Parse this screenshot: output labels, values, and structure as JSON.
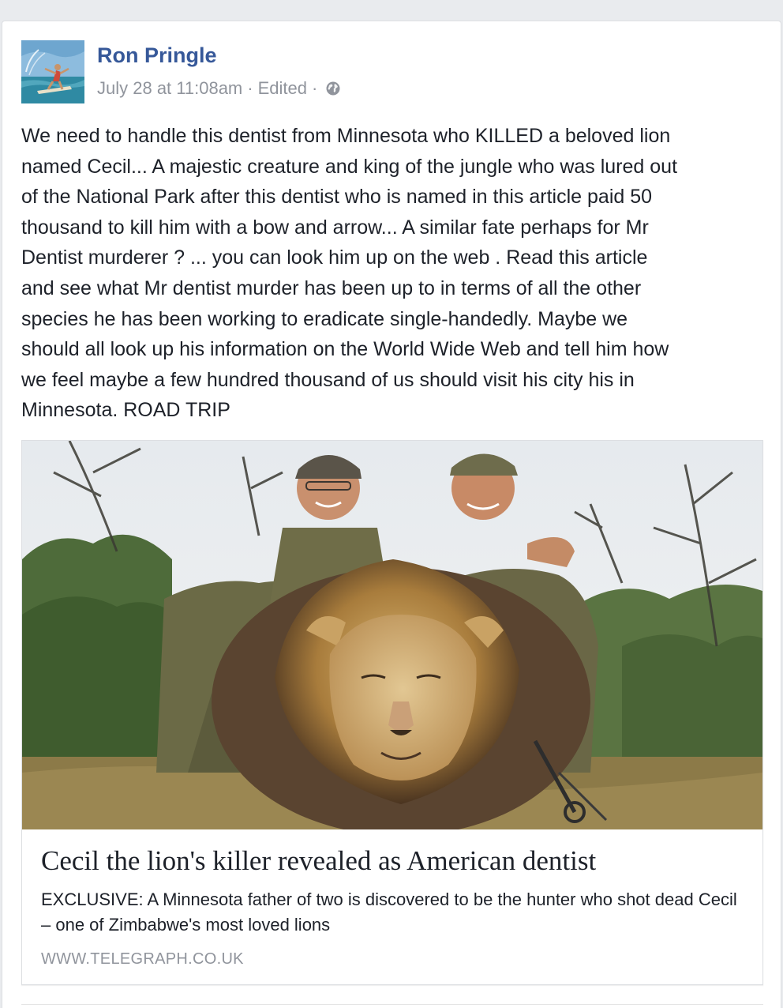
{
  "post": {
    "author": "Ron Pringle",
    "timestamp": "July 28 at 11:08am",
    "edited": "Edited",
    "privacy_icon": "globe-icon",
    "text": "We need to handle this dentist from Minnesota who KILLED a beloved lion\nnamed Cecil... A majestic creature and king of the jungle who was lured out\nof the National Park after this dentist who is named in this article paid 50\nthousand to kill him with a bow and arrow... A similar fate perhaps for Mr\nDentist murderer ? ... you can look him up on the web . Read this article\nand see what Mr dentist murder has been up to in terms of all the other\nspecies he has been working to eradicate single-handedly. Maybe we\nshould all look up his information on the World Wide Web and tell him how\nwe feel maybe a few hundred thousand of us should visit his city his in\nMinnesota. ROAD TRIP"
  },
  "link_preview": {
    "title": "Cecil the lion's killer revealed as American dentist",
    "description": "EXCLUSIVE: A Minnesota father of two is discovered to be the hunter who shot dead Cecil – one of Zimbabwe's most loved lions",
    "domain": "WWW.TELEGRAPH.CO.UK"
  },
  "colors": {
    "author_link": "#365899",
    "meta_gray": "#90949c",
    "body_text": "#1d2129",
    "page_bg": "#e9ebee"
  }
}
